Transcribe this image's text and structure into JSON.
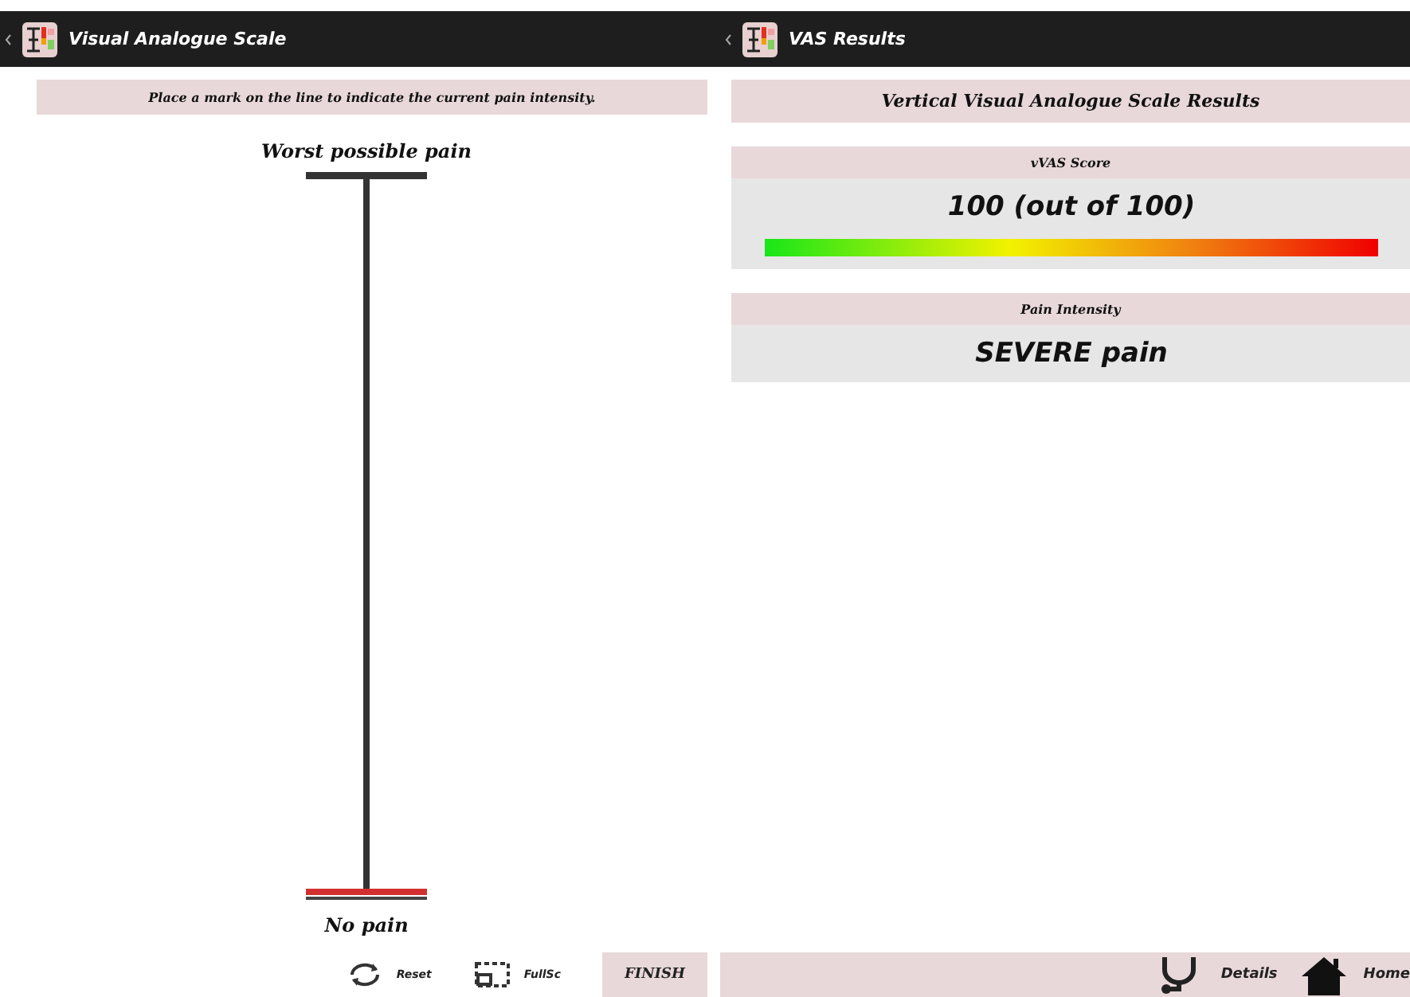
{
  "left_screen": {
    "title": "Visual Analogue Scale",
    "instruction": "Place a mark on the line to indicate the current pain intensity.",
    "scale": {
      "top_label": "Worst possible pain",
      "bottom_label": "No pain"
    },
    "toolbar": [
      {
        "kind": "reset",
        "label": "Reset"
      },
      {
        "kind": "fullscreen",
        "label": "FullSc"
      },
      {
        "kind": "finish",
        "label": "FINISH"
      }
    ]
  },
  "right_screen": {
    "title": "VAS Results",
    "heading": "Vertical Visual Analogue Scale Results",
    "sections": [
      {
        "kind": "score",
        "header": "vVAS Score",
        "value": "100 (out of 100)"
      },
      {
        "kind": "text",
        "header": "Pain Intensity",
        "value": "SEVERE pain"
      }
    ],
    "toolbar": [
      {
        "kind": "details",
        "label": "Details"
      },
      {
        "kind": "home",
        "label": "Home"
      }
    ]
  }
}
